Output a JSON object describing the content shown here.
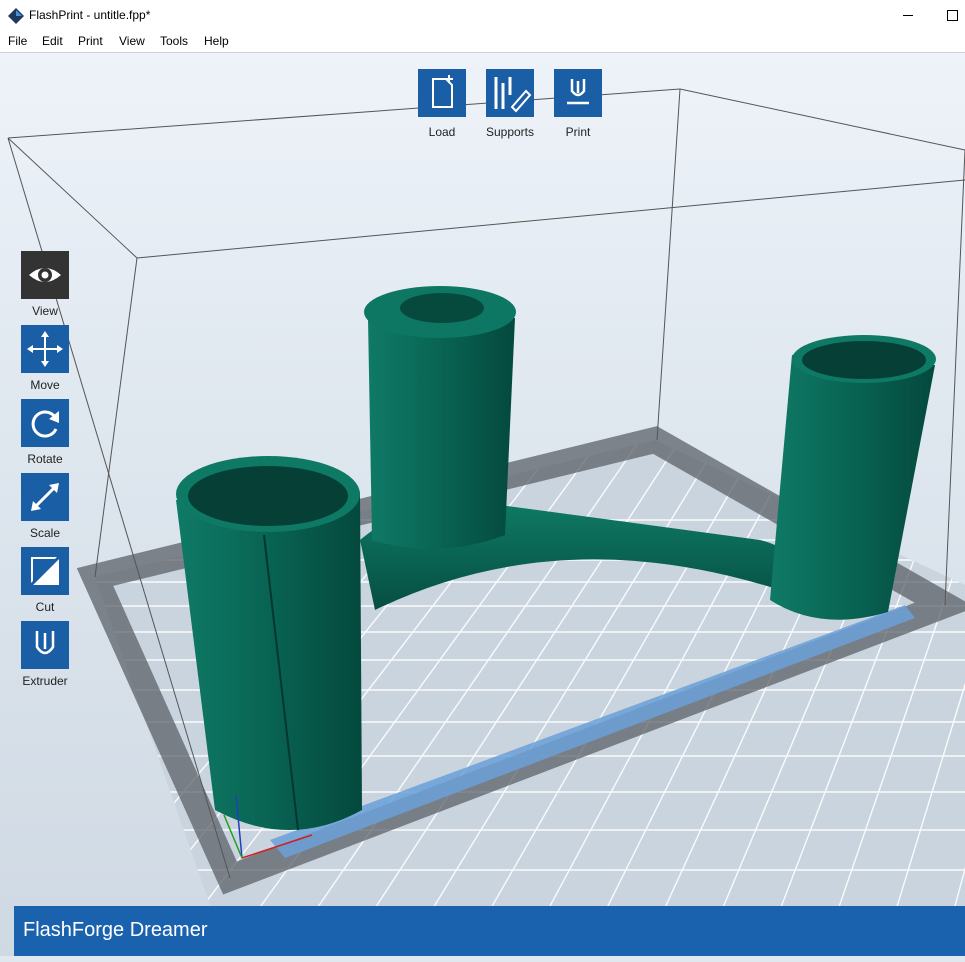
{
  "window": {
    "title": "FlashPrint - untitle.fpp*"
  },
  "menu": [
    "File",
    "Edit",
    "Print",
    "View",
    "Tools",
    "Help"
  ],
  "top_toolbar": [
    {
      "label": "Load",
      "icon": "load-file-icon"
    },
    {
      "label": "Supports",
      "icon": "supports-icon"
    },
    {
      "label": "Print",
      "icon": "print-icon"
    }
  ],
  "left_toolbar": [
    {
      "label": "View",
      "icon": "eye-icon",
      "active": true
    },
    {
      "label": "Move",
      "icon": "move-arrows-icon"
    },
    {
      "label": "Rotate",
      "icon": "rotate-icon"
    },
    {
      "label": "Scale",
      "icon": "scale-icon"
    },
    {
      "label": "Cut",
      "icon": "cut-icon"
    },
    {
      "label": "Extruder",
      "icon": "extruder-icon"
    }
  ],
  "status": {
    "printer": "FlashForge Dreamer"
  },
  "colors": {
    "accent": "#1a5ea6",
    "model": "#0a6b5a",
    "status_bar": "#1a62ad"
  }
}
